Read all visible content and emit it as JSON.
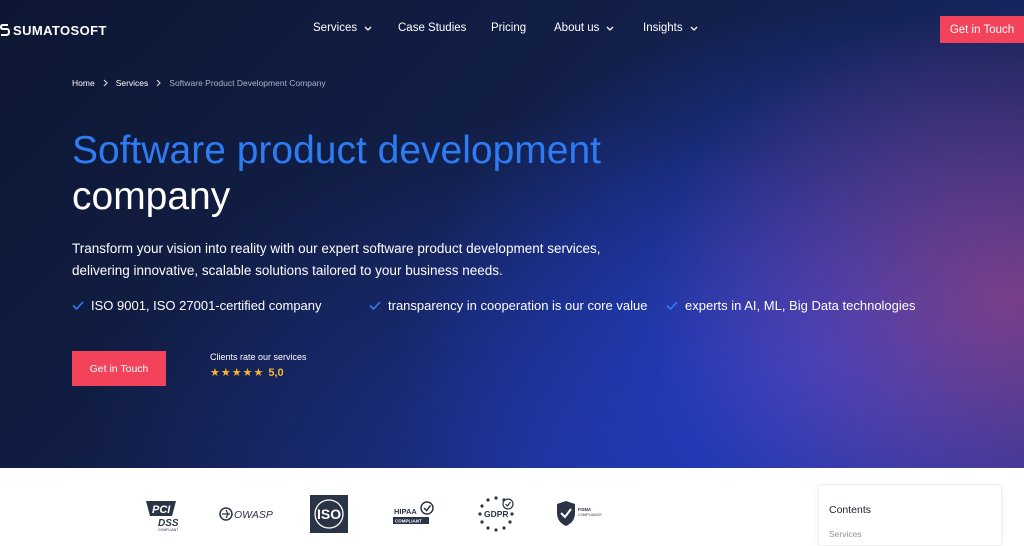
{
  "nav": {
    "logo": "SUMATOSOFT",
    "items": [
      {
        "label": "Services"
      },
      {
        "label": "Case Studies"
      },
      {
        "label": "Pricing"
      },
      {
        "label": "About us"
      },
      {
        "label": "Insights"
      }
    ],
    "cta": "Get in Touch"
  },
  "breadcrumb": [
    "Home",
    "Services",
    "Software Product Development Company"
  ],
  "hero": {
    "title_highlight": "Software product development",
    "title_rest": "company",
    "lead_line1": "Transform your vision into reality with our expert software product development services,",
    "lead_line2": "delivering innovative, scalable solutions tailored to your business needs.",
    "checks": [
      "ISO 9001, ISO 27001-certified company",
      "transparency in cooperation is our core value",
      "experts in AI, ML, Big Data technologies"
    ],
    "cta": "Get in Touch",
    "rating_label": "Clients rate our services",
    "rating_stars": 5,
    "rating_value": "5,0"
  },
  "badges": {
    "pci": [
      "PCI",
      "DSS",
      "COMPLIANT"
    ],
    "owasp": "OWASP",
    "iso": "ISO",
    "hipaa": [
      "HIPAA",
      "COMPLIANT"
    ],
    "gdpr": "GDPR",
    "fisma": [
      "FISMA",
      "COMPLIANCE"
    ]
  },
  "contents": {
    "title": "Contents",
    "first_item": "Services"
  },
  "colors": {
    "accent_blue": "#2d7cf3",
    "cta_red": "#f2435a",
    "star_gold": "#f5b82e"
  }
}
